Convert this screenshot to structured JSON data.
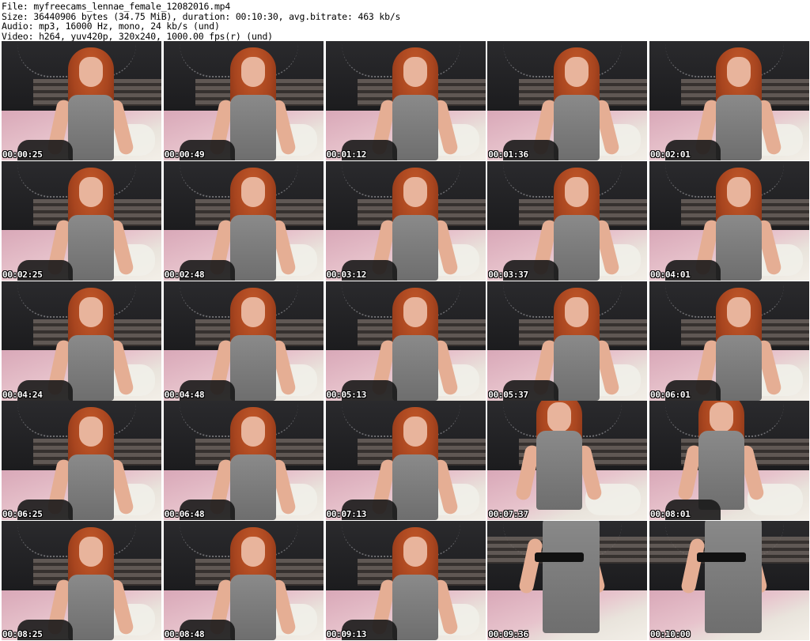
{
  "header": {
    "file_line": "File: myfreecams_lennae_female_12082016.mp4",
    "size_line": "Size: 36440906 bytes (34.75 MiB), duration: 00:10:30, avg.bitrate: 463 kb/s",
    "audio_line": "Audio: mp3, 16000 Hz, mono, 24 kb/s (und)",
    "video_line": "Video: h264, yuv420p, 320x240, 1000.00 fps(r) (und)"
  },
  "thumbnails": [
    {
      "time": "00:00:25"
    },
    {
      "time": "00:00:49"
    },
    {
      "time": "00:01:12"
    },
    {
      "time": "00:01:36"
    },
    {
      "time": "00:02:01"
    },
    {
      "time": "00:02:25"
    },
    {
      "time": "00:02:48"
    },
    {
      "time": "00:03:12"
    },
    {
      "time": "00:03:37"
    },
    {
      "time": "00:04:01"
    },
    {
      "time": "00:04:24"
    },
    {
      "time": "00:04:48"
    },
    {
      "time": "00:05:13"
    },
    {
      "time": "00:05:37"
    },
    {
      "time": "00:06:01"
    },
    {
      "time": "00:06:25"
    },
    {
      "time": "00:06:48"
    },
    {
      "time": "00:07:13"
    },
    {
      "time": "00:07:37"
    },
    {
      "time": "00:08:01"
    },
    {
      "time": "00:08:25"
    },
    {
      "time": "00:08:48"
    },
    {
      "time": "00:09:13"
    },
    {
      "time": "00:09:36"
    },
    {
      "time": "00:10:00"
    }
  ]
}
